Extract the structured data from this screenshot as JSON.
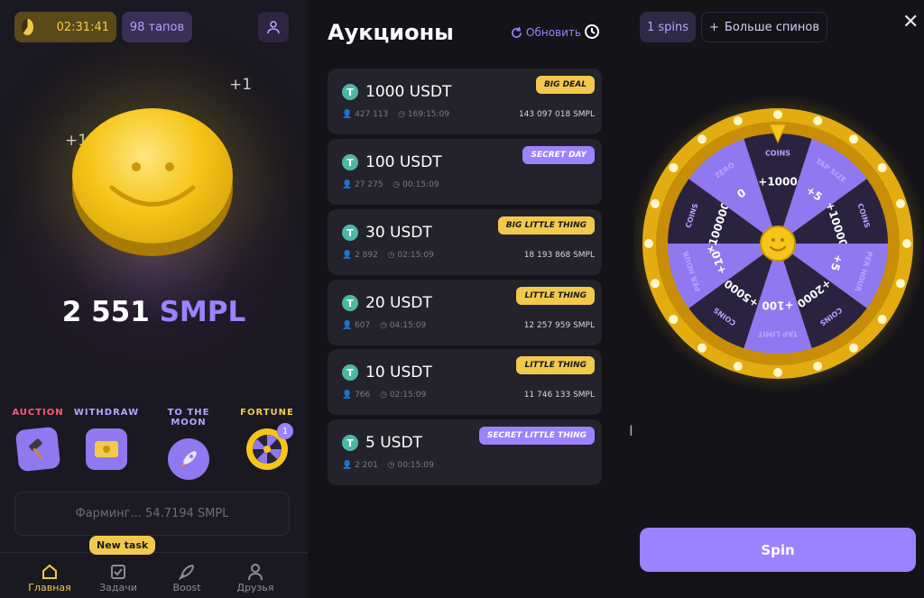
{
  "left": {
    "timer": "02:31:41",
    "taps": "98 тапов",
    "plus_left": "+1",
    "plus_right": "+1",
    "balance_number": "2 551",
    "balance_unit": "SMPL",
    "quick": [
      {
        "label": "AUCTION",
        "color": "#ff5a7a",
        "icon": "gavel-icon"
      },
      {
        "label": "WITHDRAW",
        "color": "#b8a3ff",
        "icon": "money-icon"
      },
      {
        "label": "TO THE MOON",
        "color": "#b8a3ff",
        "icon": "rocket-icon"
      },
      {
        "label": "FORTUNE",
        "color": "#f2c94c",
        "icon": "wheel-icon",
        "badge": "1"
      }
    ],
    "farming": "Фарминг... 54.7194 SMPL",
    "new_task": "New task",
    "nav": [
      {
        "label": "Главная",
        "icon": "home-icon",
        "active": true
      },
      {
        "label": "Задачи",
        "icon": "checkbox-icon",
        "active": false
      },
      {
        "label": "Boost",
        "icon": "rocket-icon",
        "active": false
      },
      {
        "label": "Друзья",
        "icon": "user-icon",
        "active": false
      }
    ]
  },
  "auctions": {
    "title": "Аукционы",
    "refresh": "Обновить",
    "items": [
      {
        "amount": "1000 USDT",
        "badge": "BIG DEAL",
        "badge_style": "gold",
        "users": "427 113",
        "time": "169:15:09",
        "smpl": "143 097 018 SMPL"
      },
      {
        "amount": "100 USDT",
        "badge": "SECRET DAY",
        "badge_style": "purple",
        "users": "27 275",
        "time": "00:15:09",
        "smpl": ""
      },
      {
        "amount": "30 USDT",
        "badge": "BIG LITTLE THING",
        "badge_style": "gold",
        "users": "2 892",
        "time": "02:15:09",
        "smpl": "18 193 868 SMPL"
      },
      {
        "amount": "20 USDT",
        "badge": "LITTLE THING",
        "badge_style": "gold",
        "users": "607",
        "time": "04:15:09",
        "smpl": "12 257 959 SMPL"
      },
      {
        "amount": "10 USDT",
        "badge": "LITTLE THING",
        "badge_style": "gold",
        "users": "766",
        "time": "02:15:09",
        "smpl": "11 746 133 SMPL"
      },
      {
        "amount": "5 USDT",
        "badge": "SECRET LITTLE THING",
        "badge_style": "purple",
        "users": "2 201",
        "time": "00:15:09",
        "smpl": ""
      }
    ]
  },
  "fortune": {
    "spins": "1 spins",
    "more_spins": "Больше спинов",
    "spin_button": "Spin",
    "segments": [
      "COINS",
      "TAP SIZE",
      "COINS",
      "PER HOUR",
      "COINS",
      "TAP LIMIT",
      "COINS",
      "PER HOUR",
      "COINS",
      "ZERO"
    ],
    "values": [
      "+1000",
      "+5",
      "+10000",
      "+5",
      "+2000",
      "+100",
      "+5000",
      "+10",
      "+1000000",
      "0"
    ],
    "colors": {
      "purple": "#8f78f0",
      "dark": "#2a2340",
      "gold": "#f5c518"
    }
  }
}
